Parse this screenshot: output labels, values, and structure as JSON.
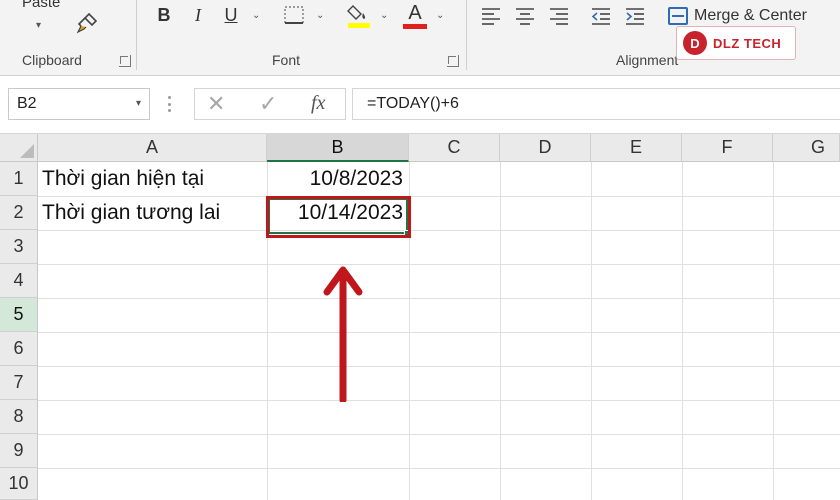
{
  "ribbon": {
    "clipboard": {
      "paste_label": "Paste",
      "group_label": "Clipboard"
    },
    "font": {
      "group_label": "Font",
      "bold_label": "B",
      "italic_label": "I",
      "underline_label": "U",
      "highlight_color": "#ffff00",
      "font_color": "#e02020",
      "font_color_glyph": "A"
    },
    "alignment": {
      "group_label": "Alignment",
      "merge_label": "Merge & Center"
    },
    "watermark": {
      "logo_text": "D",
      "text": "DLZ TECH"
    }
  },
  "formula_bar": {
    "name_box": "B2",
    "formula": "=TODAY()+6",
    "cancel_icon": "✕",
    "enter_icon": "✓",
    "fx_icon": "fx"
  },
  "sheet": {
    "columns": [
      "A",
      "B",
      "C",
      "D",
      "E",
      "F",
      "G"
    ],
    "selected_column": "B",
    "rows": [
      "1",
      "2",
      "3",
      "4",
      "5",
      "6",
      "7",
      "8",
      "9",
      "10"
    ],
    "active_row_header": "5",
    "cells": {
      "A1": "Thời gian hiện tại",
      "B1": "10/8/2023",
      "A2": "Thời gian tương lai",
      "B2": "10/14/2023"
    }
  },
  "colors": {
    "excel_green": "#217346",
    "annotation_red": "#c0171c"
  }
}
